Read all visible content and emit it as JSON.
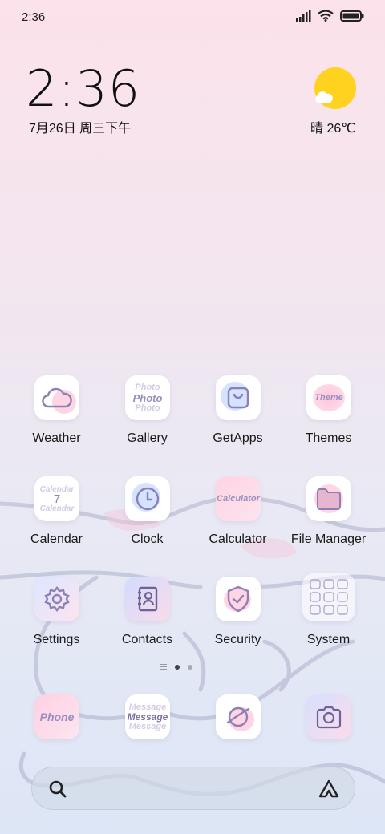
{
  "status_bar": {
    "time": "2:36",
    "icons": [
      "signal-icon",
      "wifi-icon",
      "battery-icon"
    ]
  },
  "clock_widget": {
    "time": "2:36",
    "date": "7月26日 周三下午"
  },
  "weather_widget": {
    "condition_temp": "晴 26℃",
    "icon": "sunny-icon"
  },
  "apps": [
    {
      "label": "Weather",
      "icon": "cloud-icon"
    },
    {
      "label": "Gallery",
      "icon": "photo-icon",
      "icon_text": [
        "Photo",
        "Photo",
        "Photo"
      ]
    },
    {
      "label": "GetApps",
      "icon": "shopping-bag-icon"
    },
    {
      "label": "Themes",
      "icon": "theme-icon",
      "icon_text": [
        "Theme"
      ]
    },
    {
      "label": "Calendar",
      "icon": "calendar-icon",
      "icon_text": [
        "Calendar",
        "7",
        "Calendar"
      ]
    },
    {
      "label": "Clock",
      "icon": "clock-icon"
    },
    {
      "label": "Calculator",
      "icon": "calculator-icon",
      "icon_text": [
        "Calculator"
      ]
    },
    {
      "label": "File Manager",
      "icon": "folder-icon"
    },
    {
      "label": "Settings",
      "icon": "gear-icon"
    },
    {
      "label": "Contacts",
      "icon": "contacts-icon"
    },
    {
      "label": "Security",
      "icon": "shield-icon"
    },
    {
      "label": "System",
      "icon": "system-folder-icon"
    }
  ],
  "page_indicator": {
    "pages": 2,
    "active": 1
  },
  "dock": [
    {
      "icon": "phone-icon",
      "icon_text": [
        "Phone"
      ]
    },
    {
      "icon": "message-icon",
      "icon_text": [
        "Message",
        "Message",
        "Message"
      ]
    },
    {
      "icon": "browser-icon"
    },
    {
      "icon": "camera-icon"
    }
  ],
  "search_bar": {
    "left_icon": "search-icon",
    "right_icon": "assistant-icon"
  },
  "colors": {
    "accent": "#9b8dc2",
    "sun": "#ffd21f",
    "pink": "#ffc9dc",
    "blue": "#c9dcff"
  }
}
